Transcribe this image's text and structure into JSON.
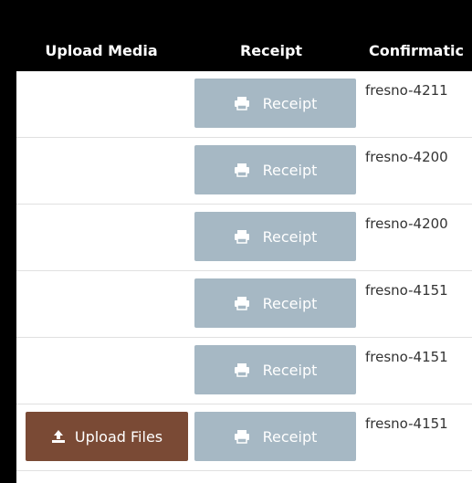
{
  "colors": {
    "header_bg": "#000000",
    "receipt_button_bg": "#a6b8c4",
    "upload_button_bg": "#7a4a35"
  },
  "table": {
    "headers": [
      "Upload Media",
      "Receipt",
      "Confirmatic"
    ],
    "rows": [
      {
        "receipt_label": "Receipt",
        "confirmation": "fresno-4211"
      },
      {
        "receipt_label": "Receipt",
        "confirmation": "fresno-4200"
      },
      {
        "receipt_label": "Receipt",
        "confirmation": "fresno-4200"
      },
      {
        "receipt_label": "Receipt",
        "confirmation": "fresno-4151"
      },
      {
        "receipt_label": "Receipt",
        "confirmation": "fresno-4151"
      },
      {
        "receipt_label": "Receipt",
        "confirmation": "fresno-4151",
        "upload_label": "Upload Files"
      }
    ]
  },
  "icons": {
    "receipt": "printer-icon",
    "upload": "upload-icon"
  }
}
